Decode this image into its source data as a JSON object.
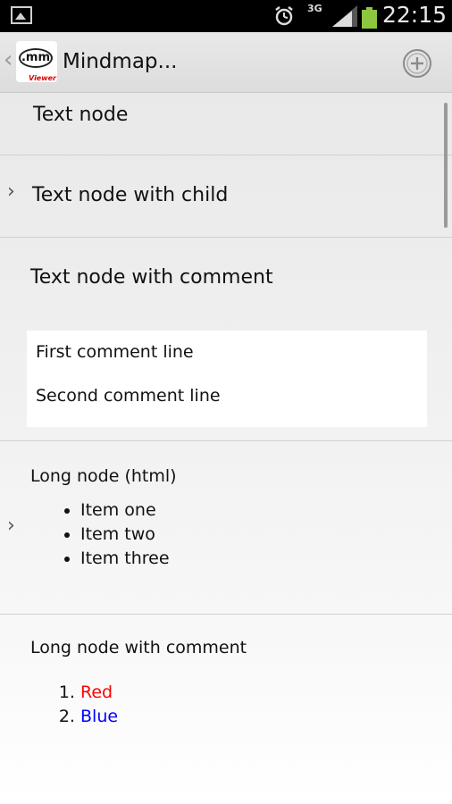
{
  "status_bar": {
    "network": "3G",
    "time": "22:15",
    "battery_color": "#8dc63f"
  },
  "action_bar": {
    "back_glyph": "‹",
    "app_icon_text": ".mm",
    "app_icon_subtext": "Viewer",
    "title": "Mindmap...",
    "add_icon": "add-circle-icon"
  },
  "nodes": [
    {
      "title": "Text node"
    },
    {
      "title": "Text node with child",
      "has_children": true
    },
    {
      "title": "Text node with comment",
      "comment_lines": [
        "First comment line",
        "Second comment line"
      ]
    },
    {
      "title": "Long node (html)",
      "has_children": true,
      "items": [
        "Item one",
        "Item two",
        "Item three"
      ]
    },
    {
      "title": "Long node with comment",
      "ordered_items": [
        {
          "text": "Red",
          "color": "#ff0000"
        },
        {
          "text": "Blue",
          "color": "#0000ff"
        }
      ]
    }
  ]
}
